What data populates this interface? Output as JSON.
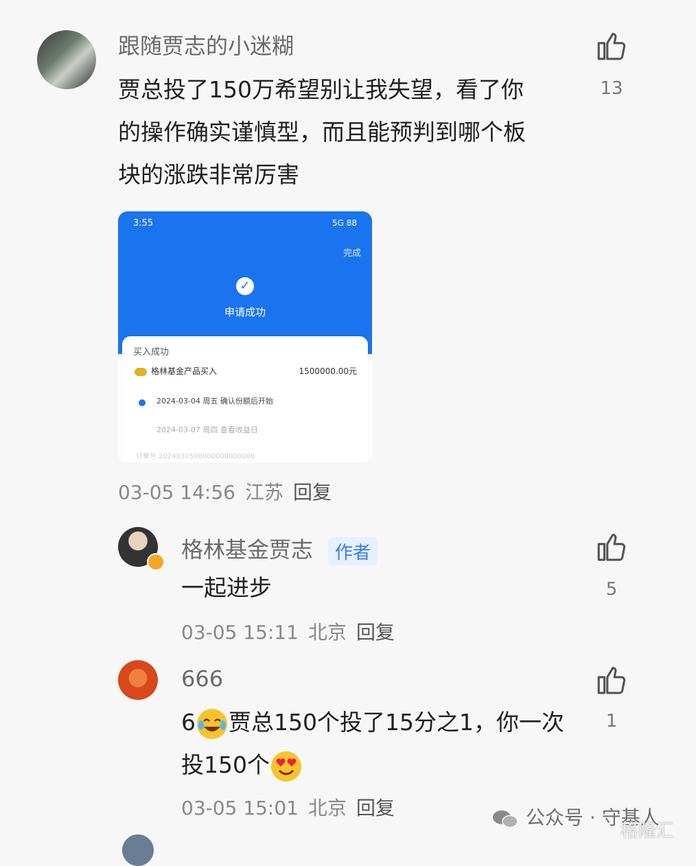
{
  "comments": [
    {
      "username": "跟随贾志的小迷糊",
      "text_lines": [
        "贾总投了150万希望别让我失望，看了你",
        "的操作确实谨慎型，而且能预判到哪个板",
        "块的涨跌非常厉害"
      ],
      "date": "03-05 14:56",
      "location": "江苏",
      "reply_label": "回复",
      "like_count": "13",
      "screenshot": {
        "status_time": "3:55",
        "status_right": "5G 88",
        "done_label": "完成",
        "check_icon": "✓",
        "success_label": "申请成功",
        "card_title": "买入成功",
        "fund_name": "格林基金产品买入",
        "fund_amount": "1500000.00元",
        "step1": "2024-03-04 周五 确认份额后开始",
        "step2": "2024-03-07 周四 查看收益日",
        "step3": "订单号 2024030500000000000000"
      }
    },
    {
      "username": "格林基金贾志",
      "badge": "作者",
      "text_lines": [
        "一起进步"
      ],
      "date": "03-05 15:11",
      "location": "北京",
      "reply_label": "回复",
      "like_count": "5"
    },
    {
      "username": "666",
      "text_parts": [
        "6",
        "贾总150个投了15分之1，你一次",
        "投150个"
      ],
      "date": "03-05 15:01",
      "location": "北京",
      "reply_label": "回复",
      "like_count": "1"
    }
  ],
  "watermark": "公众号 · 守基人",
  "watermark2": "格隆汇",
  "icons": {
    "like": "thumb-up-icon",
    "emoji1": "laughing-crying-emoji-icon",
    "emoji2": "heart-eyes-emoji-icon",
    "wechat": "wechat-icon"
  }
}
